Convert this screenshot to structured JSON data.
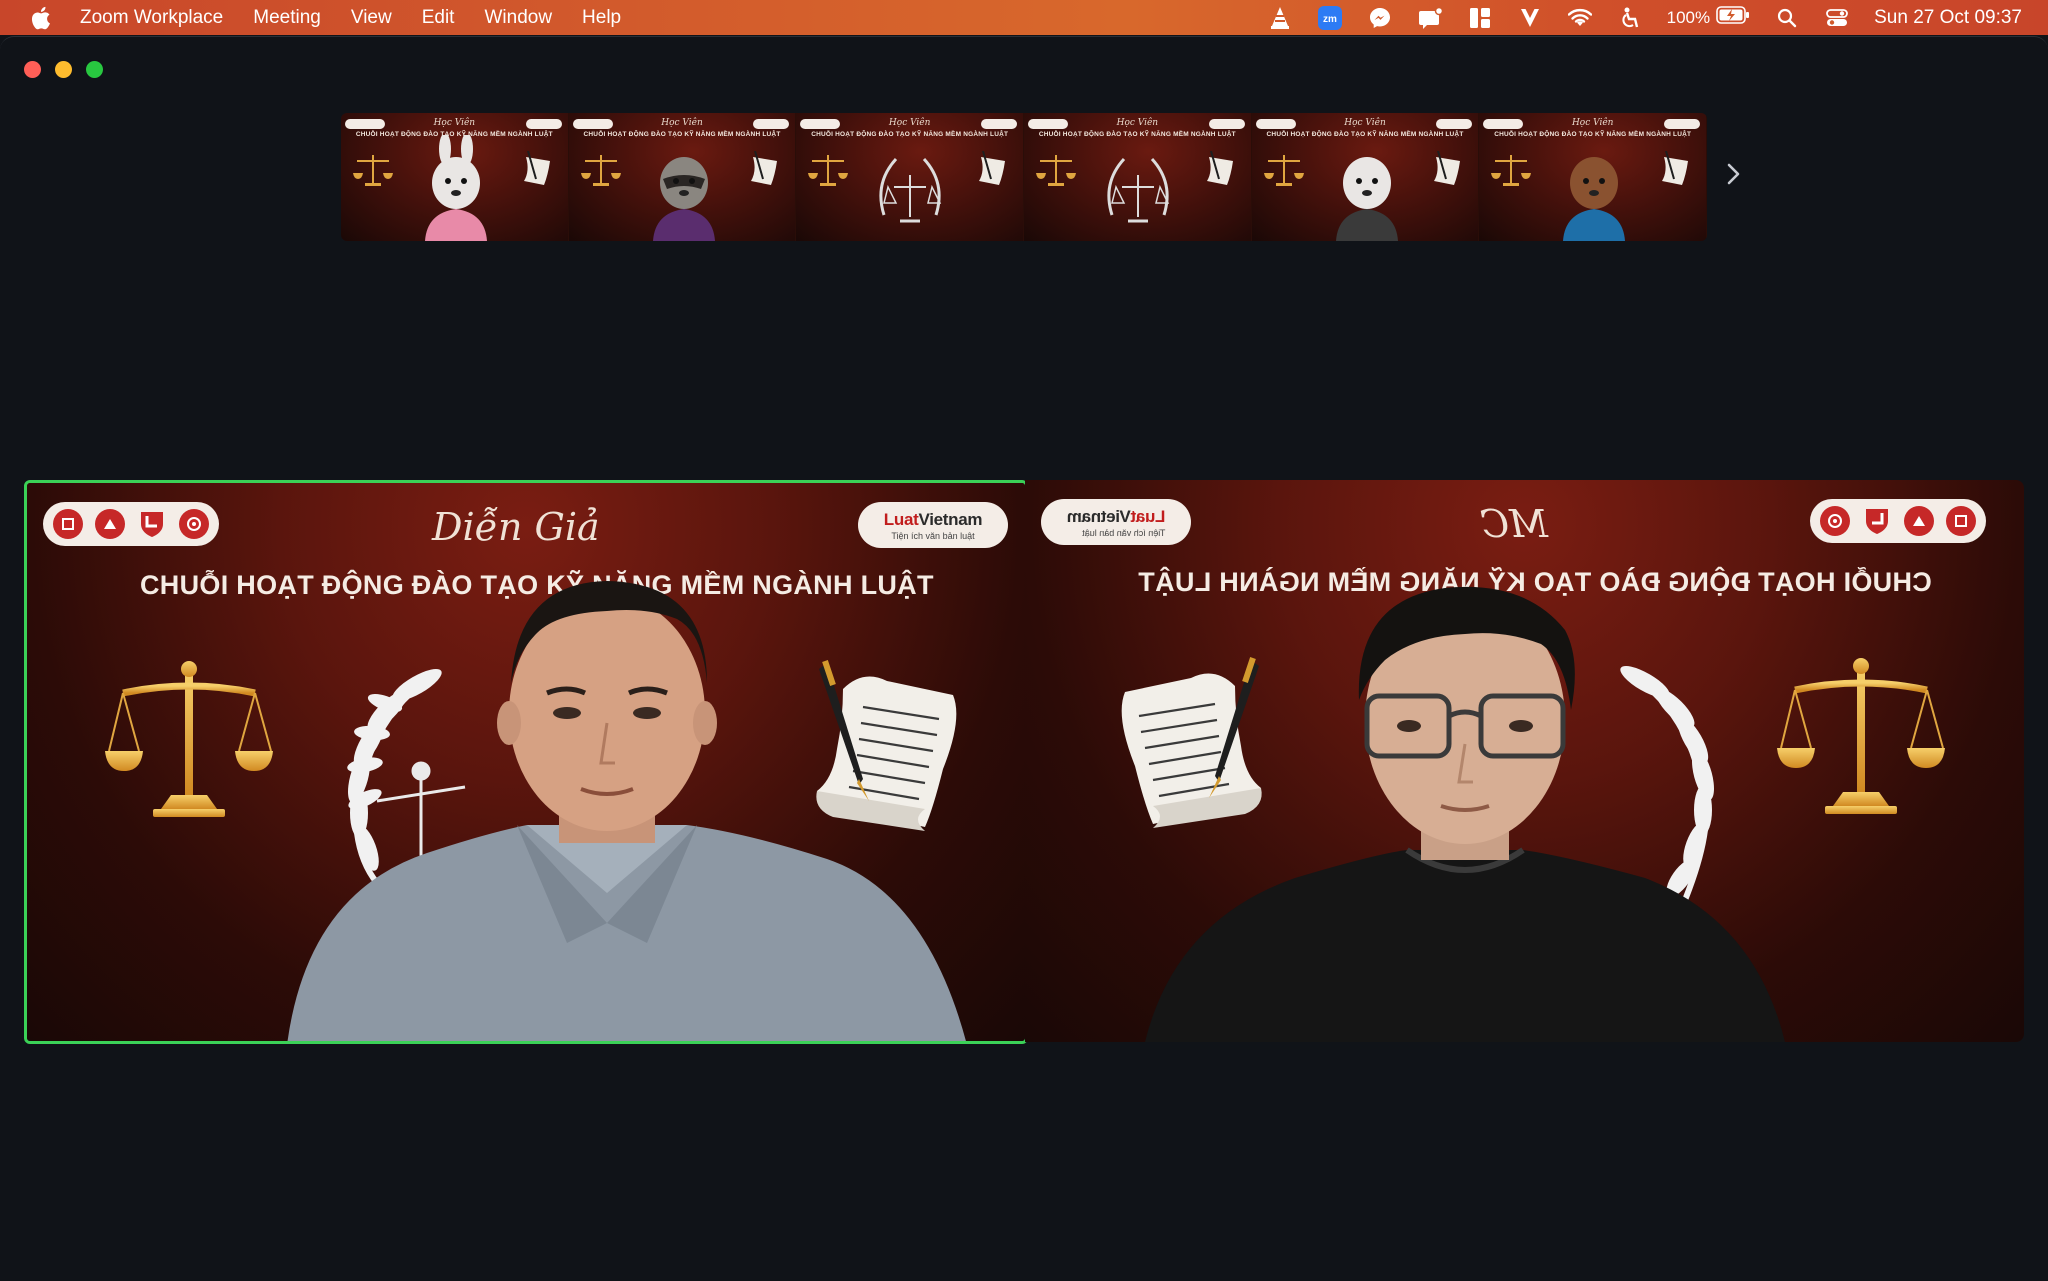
{
  "menubar": {
    "app_name": "Zoom Workplace",
    "menus": [
      "Meeting",
      "View",
      "Edit",
      "Window",
      "Help"
    ],
    "battery_percent": "100%",
    "clock": "Sun 27 Oct  09:37",
    "zoom_tray_label": "zm",
    "tray_icons": [
      "vlc-icon",
      "zoom-icon",
      "messenger-icon",
      "notification-icon",
      "grid-icon",
      "v-icon",
      "wifi-icon",
      "accessibility-icon",
      "battery-icon",
      "search-icon",
      "control-center-icon"
    ]
  },
  "window": {
    "traffic_lights": [
      "close",
      "minimize",
      "maximize"
    ]
  },
  "thumbnails": [
    {
      "script": "Học Viên",
      "title": "CHUỖI HOẠT ĐỘNG ĐÀO TẠO KỸ NĂNG MỀM NGÀNH LUẬT",
      "avatar": "bunny",
      "avatar_color": "#e88aa8"
    },
    {
      "script": "Học Viên",
      "title": "CHUỖI HOẠT ĐỘNG ĐÀO TẠO KỸ NĂNG MỀM NGÀNH LUẬT",
      "avatar": "raccoon",
      "avatar_color": "#5a2d6e"
    },
    {
      "script": "Học Viên",
      "title": "CHUỖI HOẠT ĐỘNG ĐÀO TẠO KỸ NĂNG MỀM NGÀNH LUẬT",
      "avatar": "none",
      "avatar_color": ""
    },
    {
      "script": "Học Viên",
      "title": "CHUỖI HOẠT ĐỘNG ĐÀO TẠO KỸ NĂNG MỀM NGÀNH LUẬT",
      "avatar": "none",
      "avatar_color": ""
    },
    {
      "script": "Học Viên",
      "title": "CHUỖI HOẠT ĐỘNG ĐÀO TẠO KỸ NĂNG MỀM NGÀNH LUẬT",
      "avatar": "polar-bear",
      "avatar_color": "#3a3a3a"
    },
    {
      "script": "Học Viên",
      "title": "CHUỖI HOẠT ĐỘNG ĐÀO TẠO KỸ NĂNG MỀM NGÀNH LUẬT",
      "avatar": "beaver",
      "avatar_color": "#1e6fa8"
    }
  ],
  "tiles": {
    "left": {
      "script": "Diễn Giả",
      "banner": "CHUỖI HOẠT ĐỘNG ĐÀO TẠO KỸ NĂNG MỀM NGÀNH LUẬT",
      "logo_main_a": "Luat",
      "logo_main_b": "Vietnam",
      "logo_sub": "Tiện ích văn bản luật",
      "active_speaker": true
    },
    "right": {
      "script": "MC",
      "banner": "CHUỖI HOẠT ĐỘNG ĐÀO TẠO KỸ NĂNG MỀM NGÀNH LUẬT",
      "logo_main_a": "Luat",
      "logo_main_b": "Vietnam",
      "logo_sub": "Tiện ích văn bản luật",
      "mirrored": true
    }
  },
  "colors": {
    "menubar": "#d05a2b",
    "window_bg": "#101318",
    "active_border": "#3bd157",
    "slide_red": "#5a150d",
    "gold": "#e8a93a"
  }
}
